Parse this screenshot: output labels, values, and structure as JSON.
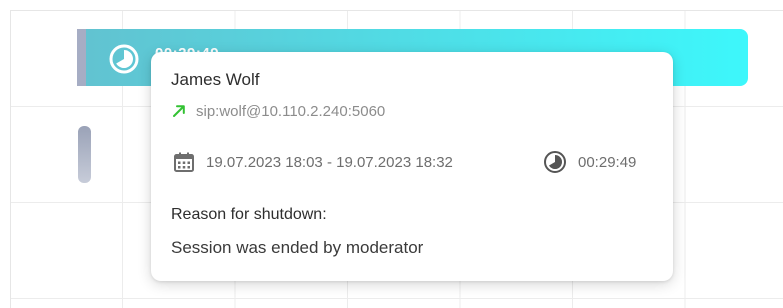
{
  "session_bar": {
    "time": "00:29:49",
    "icon": "timer-icon"
  },
  "popup": {
    "name": "James Wolf",
    "address": {
      "icon": "outgoing-arrow-icon",
      "text": "sip:wolf@10.110.2.240:5060"
    },
    "dates": {
      "icon": "calendar-icon",
      "text": "19.07.2023 18:03 - 19.07.2023 18:32"
    },
    "duration": {
      "icon": "timer-icon",
      "text": "00:29:49"
    },
    "reason_label": "Reason for shutdown:",
    "reason_text": "Session was ended by moderator"
  },
  "colors": {
    "bar_gradient_start": "#62c2d0",
    "bar_gradient_end": "#3df7fb",
    "outgoing_arrow": "#33c233"
  }
}
